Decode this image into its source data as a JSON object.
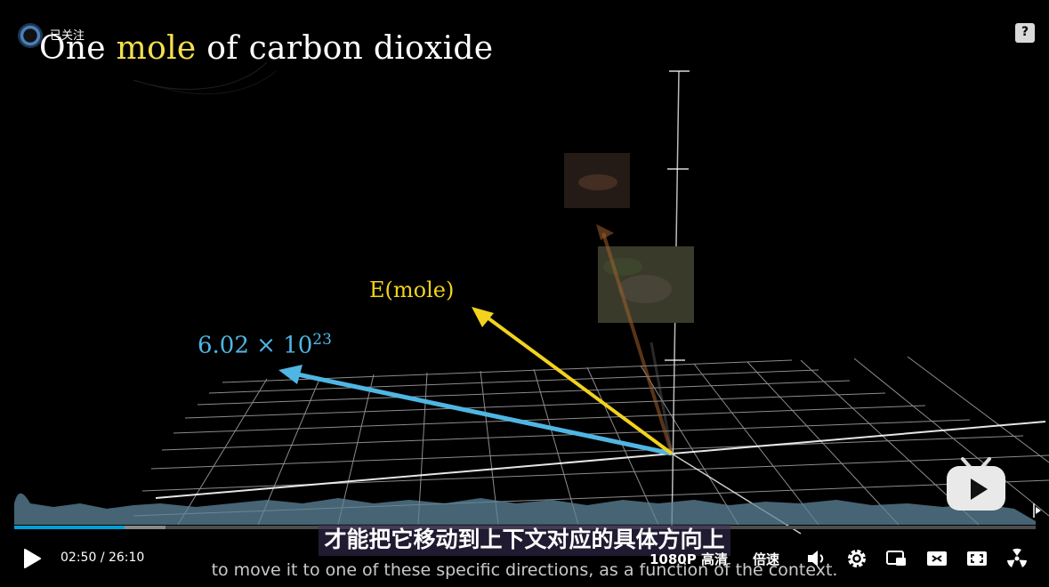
{
  "video": {
    "title_prefix": "One ",
    "title_highlight": "mole",
    "title_suffix": " of carbon dioxide",
    "label_yellow": "E(mole)",
    "label_blue_base": "6.02 × 10",
    "label_blue_exp": "23",
    "colors": {
      "yellow": "#f2d21e",
      "blue": "#4fb6e4",
      "brown": "#a0602c"
    }
  },
  "channel": {
    "follow_label": "已关注",
    "logo_icon": "channel-avatar"
  },
  "player": {
    "current_time": "02:50",
    "separator": "/",
    "total_time": "26:10",
    "played_fraction": 0.108,
    "buffered_fraction": 0.148,
    "quality_label": "1080P 高清",
    "speed_label": "倍速",
    "accent_color": "#00a1d6"
  },
  "subtitles": {
    "zh": "才能把它移动到上下文对应的具体方向上",
    "en": "to move it to one of these specific directions, as a function of the context."
  }
}
